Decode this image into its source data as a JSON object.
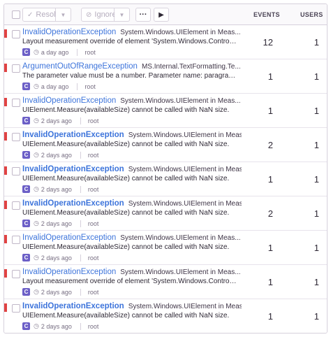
{
  "toolbar": {
    "resolve_label": "Resolve",
    "ignore_label": "Ignore",
    "more_label": "···",
    "play_label": "▶",
    "events_header": "EVENTS",
    "users_header": "USERS"
  },
  "colors": {
    "level": "#e04343",
    "link": "#3d74db",
    "badge": "#6c5fc7"
  },
  "issues": [
    {
      "type": "InvalidOperationException",
      "culprit": "System.Windows.UIElement in Meas...",
      "message": "Layout measurement override of element 'System.Windows.Controls.Te...",
      "badge": "C",
      "time": "a day ago",
      "user": "root",
      "events": "12",
      "users": "1",
      "bold": false
    },
    {
      "type": "ArgumentOutOfRangeException",
      "culprit": "MS.Internal.TextFormatting.Te...",
      "message": "The parameter value must be a number. Parameter name: paragraph...",
      "badge": "C",
      "time": "a day ago",
      "user": "root",
      "events": "1",
      "users": "1",
      "bold": false
    },
    {
      "type": "InvalidOperationException",
      "culprit": "System.Windows.UIElement in Meas...",
      "message": "UIElement.Measure(availableSize) cannot be called with NaN size.",
      "badge": "C",
      "time": "2 days ago",
      "user": "root",
      "events": "1",
      "users": "1",
      "bold": false
    },
    {
      "type": "InvalidOperationException",
      "culprit": "System.Windows.UIElement in Meas...",
      "message": "UIElement.Measure(availableSize) cannot be called with NaN size.",
      "badge": "C",
      "time": "2 days ago",
      "user": "root",
      "events": "2",
      "users": "1",
      "bold": true
    },
    {
      "type": "InvalidOperationException",
      "culprit": "System.Windows.UIElement in Meas...",
      "message": "UIElement.Measure(availableSize) cannot be called with NaN size.",
      "badge": "C",
      "time": "2 days ago",
      "user": "root",
      "events": "1",
      "users": "1",
      "bold": true
    },
    {
      "type": "InvalidOperationException",
      "culprit": "System.Windows.UIElement in Meas...",
      "message": "UIElement.Measure(availableSize) cannot be called with NaN size.",
      "badge": "C",
      "time": "2 days ago",
      "user": "root",
      "events": "2",
      "users": "1",
      "bold": true
    },
    {
      "type": "InvalidOperationException",
      "culprit": "System.Windows.UIElement in Meas...",
      "message": "UIElement.Measure(availableSize) cannot be called with NaN size.",
      "badge": "C",
      "time": "2 days ago",
      "user": "root",
      "events": "1",
      "users": "1",
      "bold": false
    },
    {
      "type": "InvalidOperationException",
      "culprit": "System.Windows.UIElement in Meas...",
      "message": "Layout measurement override of element 'System.Windows.Controls.Te...",
      "badge": "C",
      "time": "2 days ago",
      "user": "root",
      "events": "1",
      "users": "1",
      "bold": false
    },
    {
      "type": "InvalidOperationException",
      "culprit": "System.Windows.UIElement in Meas...",
      "message": "UIElement.Measure(availableSize) cannot be called with NaN size.",
      "badge": "C",
      "time": "2 days ago",
      "user": "root",
      "events": "1",
      "users": "1",
      "bold": true
    }
  ]
}
